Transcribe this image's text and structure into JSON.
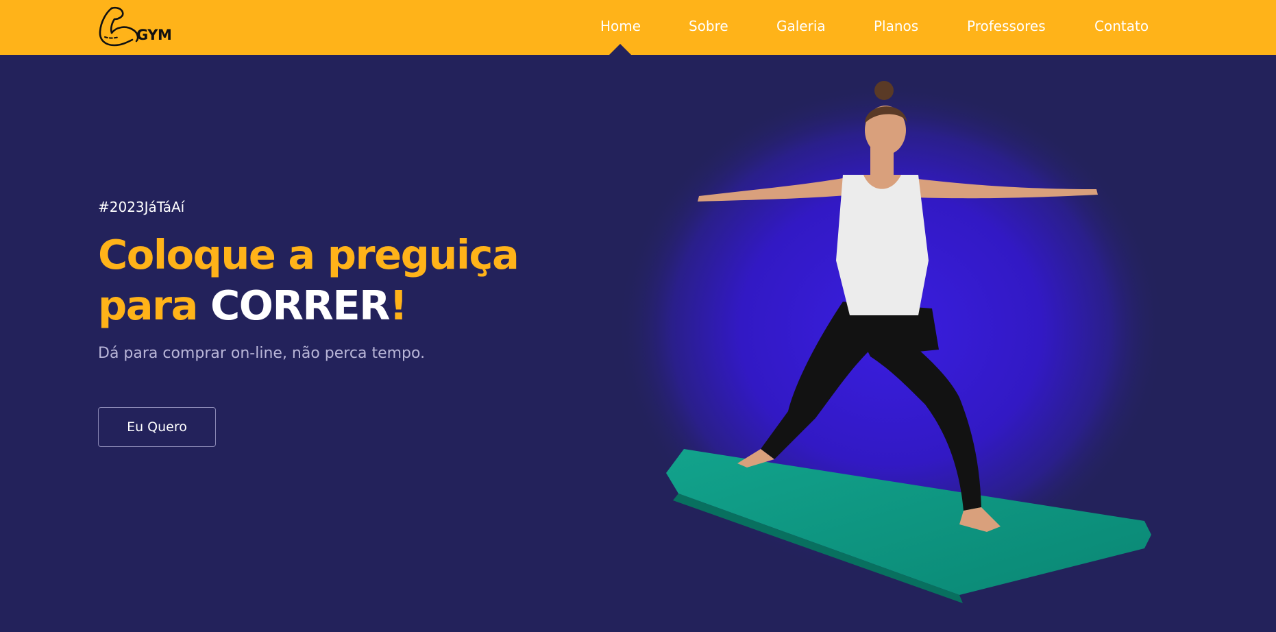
{
  "brand": {
    "logo_text": "GYM",
    "icon": "flexed-bicep-icon"
  },
  "colors": {
    "header_bg": "#ffb319",
    "page_bg": "#23225b",
    "accent": "#ffb319",
    "glow": "#3a1ee0",
    "mat": "#0d9a85"
  },
  "nav": {
    "items": [
      {
        "label": "Home",
        "active": true
      },
      {
        "label": "Sobre"
      },
      {
        "label": "Galeria"
      },
      {
        "label": "Planos"
      },
      {
        "label": "Professores"
      },
      {
        "label": "Contato"
      }
    ]
  },
  "hero": {
    "hashtag": "#2023JáTáAí",
    "headline_line1": "Coloque a preguiça",
    "headline_line2_a": "para ",
    "headline_line2_b": "CORRER",
    "headline_line2_c": "!",
    "subtitle": "Dá para comprar on-line, não perca tempo.",
    "cta_label": "Eu Quero",
    "image": "woman-yoga-warrior-pose-on-green-mat"
  }
}
